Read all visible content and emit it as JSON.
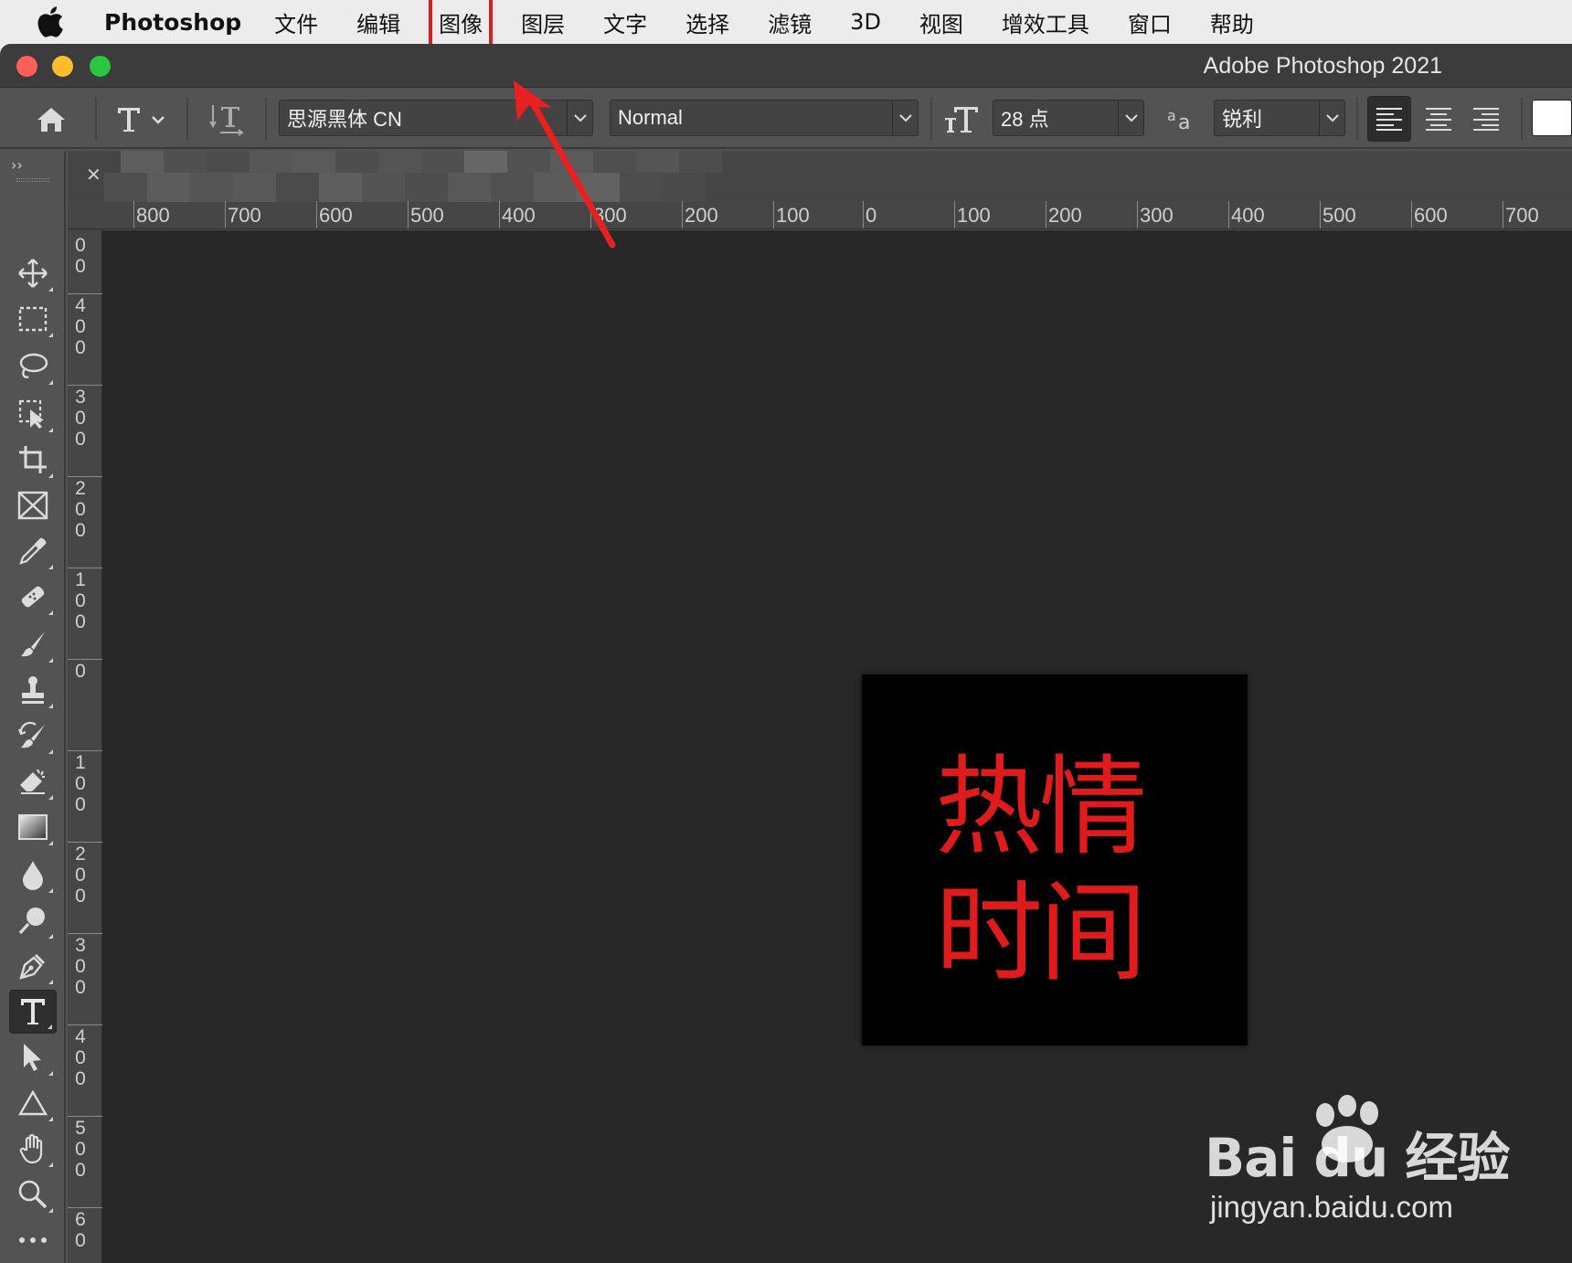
{
  "menubar": {
    "app": "Photoshop",
    "items": [
      "文件",
      "编辑",
      "图像",
      "图层",
      "文字",
      "选择",
      "滤镜",
      "3D",
      "视图",
      "增效工具",
      "窗口",
      "帮助"
    ],
    "highlight_color": "#e41b1b"
  },
  "window": {
    "title": "Adobe Photoshop 2021"
  },
  "options": {
    "font_family": "思源黑体 CN",
    "font_style": "Normal",
    "font_size": "28 点",
    "antialias": "锐利"
  },
  "ruler": {
    "h_labels": [
      "800",
      "700",
      "600",
      "500",
      "400",
      "300",
      "200",
      "100",
      "0",
      "100",
      "200",
      "300",
      "400",
      "500",
      "600",
      "700"
    ],
    "v_labels": [
      "0\n0",
      "4\n0\n0",
      "3\n0\n0",
      "2\n0\n0",
      "1\n0\n0",
      "0",
      "1\n0\n0",
      "2\n0\n0",
      "3\n0\n0",
      "4\n0\n0",
      "5\n0\n0",
      "6\n0"
    ]
  },
  "canvas": {
    "text": "热情\n时间",
    "text_color": "#e01b1b",
    "background": "#000000"
  },
  "watermark": {
    "logo": "Bai du 经验",
    "url": "jingyan.baidu.com"
  }
}
